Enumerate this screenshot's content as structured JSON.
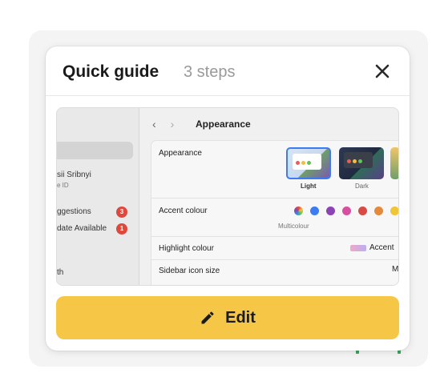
{
  "guide": {
    "title": "Quick guide",
    "steps": "3 steps",
    "close_icon": "close-icon"
  },
  "screenshot": {
    "sidebar": {
      "user_name": "sii Sribnyi",
      "user_sub": "e ID",
      "items": [
        {
          "label": "ggestions",
          "badge": "3"
        },
        {
          "label": "date Available",
          "badge": "1"
        }
      ],
      "bottom_item": "th"
    },
    "pane": {
      "title": "Appearance",
      "rows": {
        "appearance": "Appearance",
        "accent": "Accent colour",
        "highlight": "Highlight colour",
        "icon_size": "Sidebar icon size"
      },
      "modes": {
        "light": "Light",
        "dark": "Dark"
      },
      "accent_caption": "Multicolour",
      "accent_colors": [
        "#3b7cf5",
        "#8a44b4",
        "#d84fa0",
        "#d84a44",
        "#e58a3a",
        "#f0c53a"
      ],
      "highlight_value": "Accent",
      "icon_size_value": "M"
    }
  },
  "actions": {
    "edit_label": "Edit",
    "edit_icon": "pencil-icon"
  },
  "colors": {
    "edit_button": "#f6c647",
    "selected_mode": "#3b7cf5",
    "badge": "#e0483c"
  }
}
